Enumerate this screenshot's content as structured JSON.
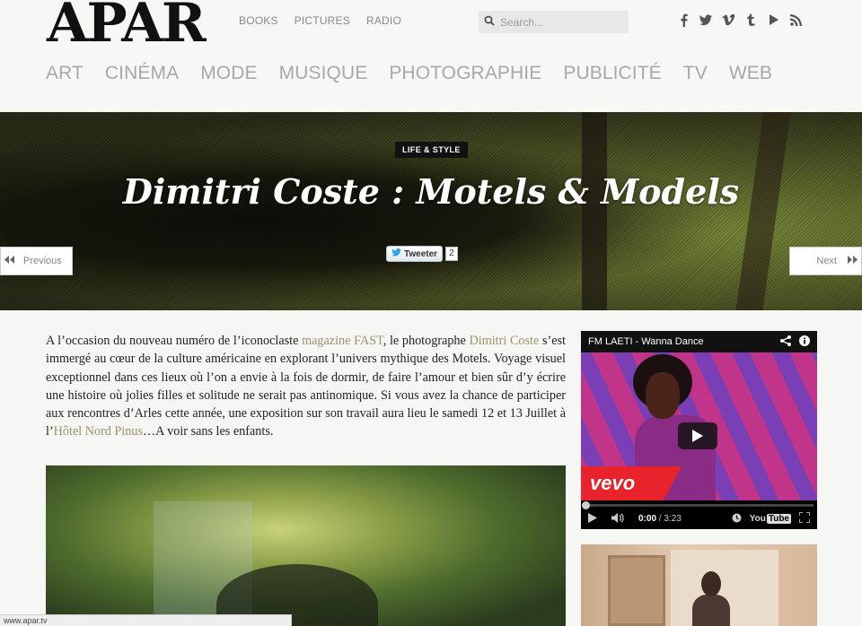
{
  "site": {
    "logo": "APAR"
  },
  "top_nav": [
    "BOOKS",
    "PICTURES",
    "RADIO"
  ],
  "search": {
    "placeholder": "Search..."
  },
  "social_icons": [
    "facebook-icon",
    "twitter-icon",
    "vimeo-icon",
    "tumblr-icon",
    "youtube-icon",
    "rss-icon"
  ],
  "main_nav": [
    "ART",
    "CINÉMA",
    "MODE",
    "MUSIQUE",
    "PHOTOGRAPHIE",
    "PUBLICITÉ",
    "TV",
    "WEB"
  ],
  "hero": {
    "category": "LIFE & STYLE",
    "title": "Dimitri Coste : Motels & Models",
    "tweet_label": "Tweeter",
    "tweet_count": "2",
    "previous_label": "Previous",
    "next_label": "Next"
  },
  "article": {
    "p1": "A l’occasion du nouveau numéro de l’iconoclaste ",
    "link_magazine": "magazine FAST",
    "p2": ", le photographe ",
    "link_author": "Dimitri Coste",
    "p3": " s’est immergé au cœur de la culture américaine en explorant l’univers mythique des Motels. Voyage visuel exceptionnel dans ces lieux où l’on a envie à la fois de dormir, de faire l’amour et bien sûr d’y écrire une histoire où jolies filles et solitude ne serait pas antinomique. Si vous avez la chance de participer aux rencontres d’Arles cette année, une exposition sur son travail aura lieu le samedi 12 et 13 Juillet à l’",
    "link_hotel": "Hôtel Nord Pinus",
    "p4": "…A voir sans les enfants."
  },
  "video": {
    "title": "FM LAETI - Wanna Dance",
    "brand": "vevo",
    "time_current": "0:00",
    "time_total": "/ 3:23",
    "progress": 0,
    "youtube_label": "You",
    "youtube_tube": "Tube"
  },
  "status_bar": {
    "url": "www.apar.tv"
  }
}
